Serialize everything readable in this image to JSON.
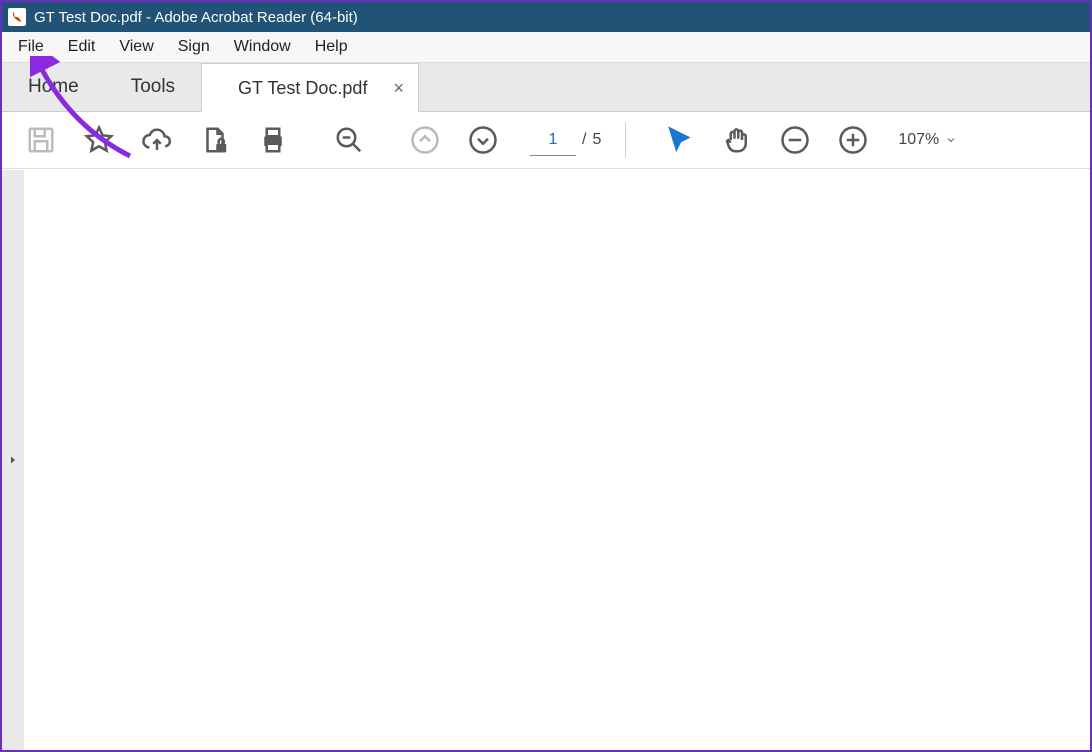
{
  "title_bar": {
    "text": "GT Test Doc.pdf - Adobe Acrobat Reader (64-bit)"
  },
  "menu": {
    "file": "File",
    "edit": "Edit",
    "view": "View",
    "sign": "Sign",
    "window": "Window",
    "help": "Help"
  },
  "tabs": {
    "home": "Home",
    "tools": "Tools",
    "doc": "GT Test Doc.pdf"
  },
  "page": {
    "current": "1",
    "sep": "/",
    "total": "5"
  },
  "zoom": {
    "label": "107%"
  }
}
